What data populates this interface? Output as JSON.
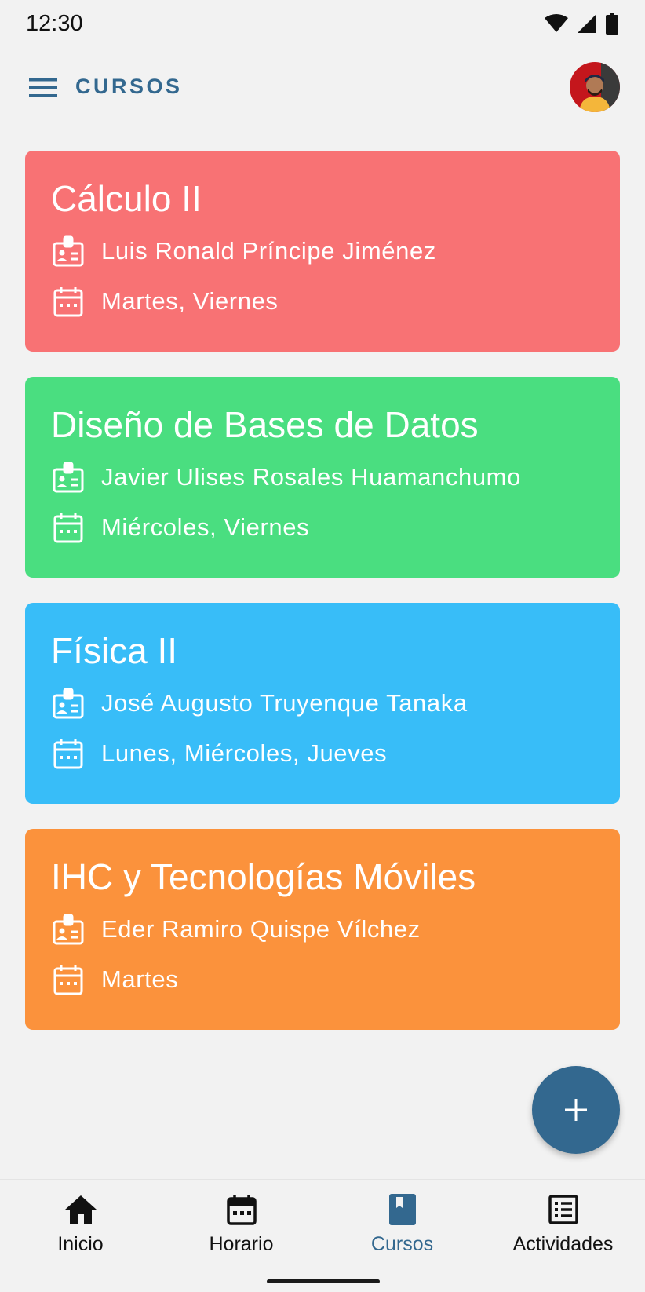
{
  "status_bar": {
    "time": "12:30",
    "icons": [
      "wifi-icon",
      "cell-signal-icon",
      "battery-icon"
    ]
  },
  "app_bar": {
    "title": "CURSOS",
    "menu_icon": "hamburger-menu-icon",
    "avatar": "user-avatar"
  },
  "courses": [
    {
      "title": "Cálculo II",
      "teacher": "Luis Ronald Príncipe Jiménez",
      "days": "Martes, Viernes",
      "color": "#f87274"
    },
    {
      "title": "Diseño de Bases de Datos",
      "teacher": "Javier Ulises Rosales Huamanchumo",
      "days": "Miércoles, Viernes",
      "color": "#4ade80"
    },
    {
      "title": "Física II",
      "teacher": "José Augusto Truyenque Tanaka",
      "days": "Lunes, Miércoles, Jueves",
      "color": "#38bdf8"
    },
    {
      "title": "IHC y Tecnologías Móviles",
      "teacher": "Eder Ramiro Quispe Vílchez",
      "days": "Martes",
      "color": "#fb923c"
    }
  ],
  "fab": {
    "icon": "plus-icon",
    "color": "#33688f"
  },
  "bottom_nav": {
    "items": [
      {
        "label": "Inicio",
        "icon": "home-icon",
        "active": false
      },
      {
        "label": "Horario",
        "icon": "calendar-icon",
        "active": false
      },
      {
        "label": "Cursos",
        "icon": "book-icon",
        "active": true
      },
      {
        "label": "Actividades",
        "icon": "list-icon",
        "active": false
      }
    ],
    "active_color": "#33688f"
  }
}
